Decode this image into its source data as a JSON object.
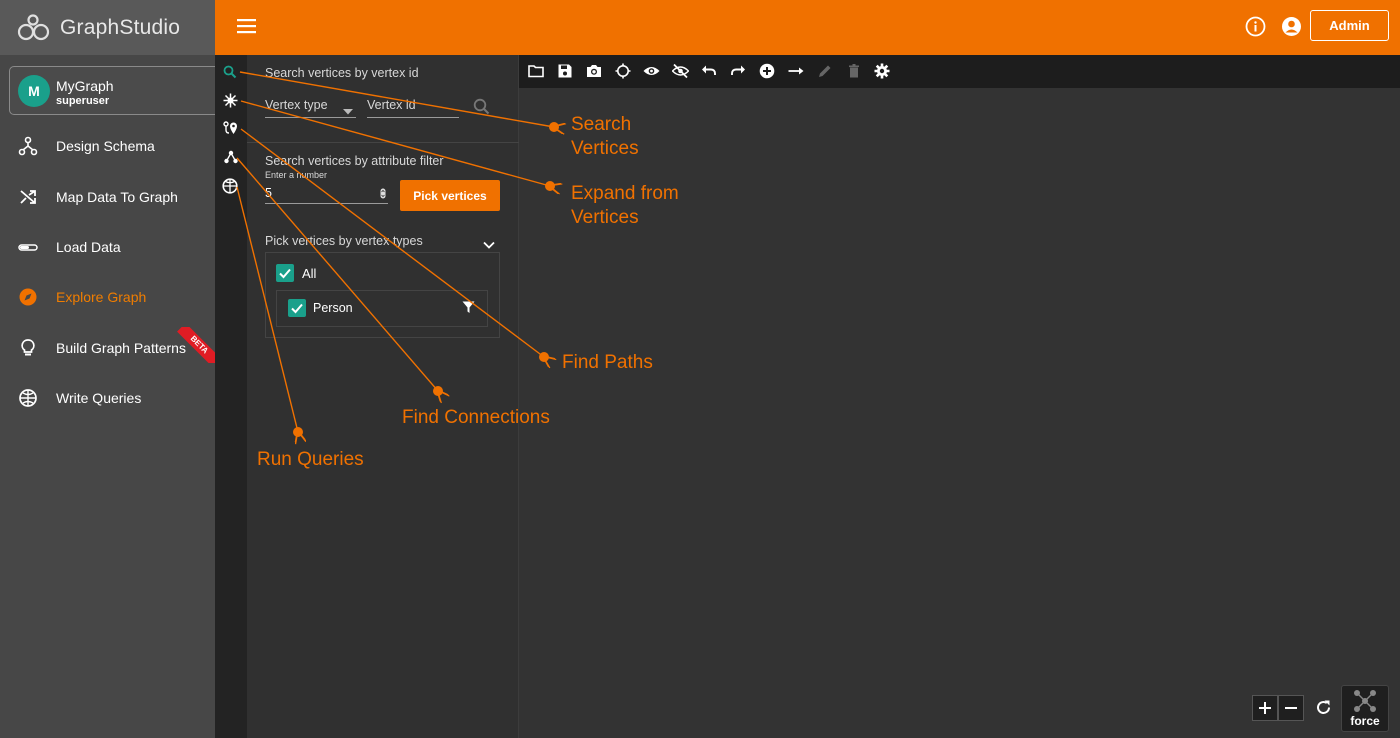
{
  "app": {
    "name": "GraphStudio"
  },
  "graph": {
    "avatar_letter": "M",
    "name": "MyGraph",
    "role": "superuser"
  },
  "nav": {
    "items": [
      {
        "label": "Design Schema"
      },
      {
        "label": "Map Data To Graph"
      },
      {
        "label": "Load Data"
      },
      {
        "label": "Explore Graph"
      },
      {
        "label": "Build Graph Patterns"
      },
      {
        "label": "Write Queries"
      }
    ],
    "beta_label": "BETA"
  },
  "header": {
    "admin_label": "Admin"
  },
  "panel": {
    "search_title": "Search vertices by vertex id",
    "vertex_type_placeholder": "Vertex type",
    "vertex_id_placeholder": "Vertex id",
    "attr_title": "Search vertices by attribute filter",
    "number_hint": "Enter a number",
    "number_value": "5",
    "pick_button": "Pick vertices",
    "types_title": "Pick vertices by vertex types",
    "all_label": "All",
    "person_label": "Person"
  },
  "canvas": {
    "layout_label": "force"
  },
  "callouts": {
    "search": [
      "Search",
      "Vertices"
    ],
    "expand": [
      "Expand from",
      "Vertices"
    ],
    "paths": "Find Paths",
    "connections": "Find Connections",
    "queries": "Run Queries"
  },
  "colors": {
    "accent": "#f07100",
    "sidebar": "#474747",
    "panel": "#303030",
    "canvas": "#333333",
    "teal": "#1aa08b"
  }
}
